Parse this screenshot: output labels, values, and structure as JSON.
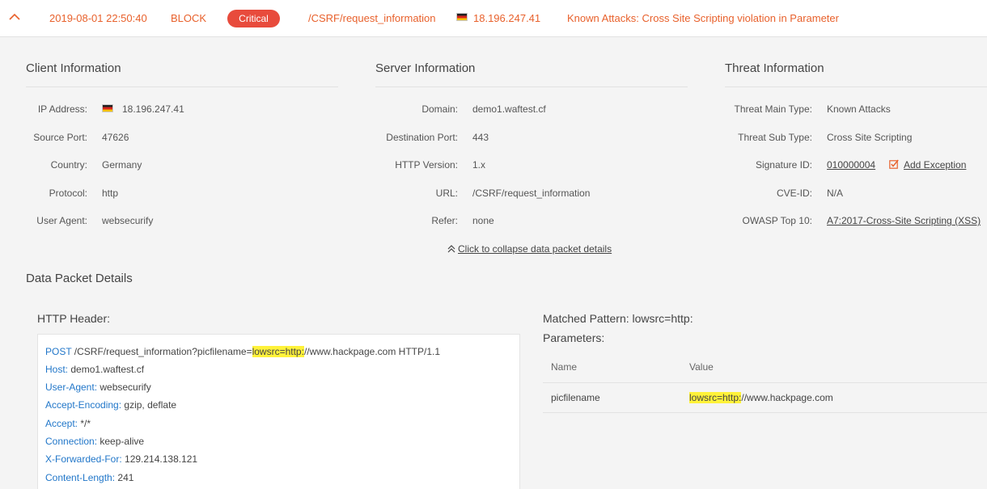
{
  "event": {
    "timestamp": "2019-08-01 22:50:40",
    "action": "BLOCK",
    "severity": "Critical",
    "url": "/CSRF/request_information",
    "ip": "18.196.247.41",
    "description": "Known Attacks: Cross Site Scripting violation in Parameter"
  },
  "client": {
    "title": "Client Information",
    "labels": {
      "ip": "IP Address:",
      "port": "Source Port:",
      "country": "Country:",
      "protocol": "Protocol:",
      "agent": "User Agent:"
    },
    "values": {
      "ip": "18.196.247.41",
      "port": "47626",
      "country": "Germany",
      "protocol": "http",
      "agent": "websecurify"
    }
  },
  "server": {
    "title": "Server Information",
    "labels": {
      "domain": "Domain:",
      "port": "Destination Port:",
      "http": "HTTP Version:",
      "url": "URL:",
      "refer": "Refer:"
    },
    "values": {
      "domain": "demo1.waftest.cf",
      "port": "443",
      "http": "1.x",
      "url": "/CSRF/request_information",
      "refer": "none"
    }
  },
  "threat": {
    "title": "Threat Information",
    "labels": {
      "main": "Threat Main Type:",
      "sub": "Threat Sub Type:",
      "sig": "Signature ID:",
      "cve": "CVE-ID:",
      "owasp": "OWASP Top 10:"
    },
    "values": {
      "main": "Known Attacks",
      "sub": "Cross Site Scripting",
      "sig": "010000004",
      "add_exception": "Add Exception",
      "cve": "N/A",
      "owasp": "A7:2017-Cross-Site Scripting (XSS)"
    }
  },
  "collapse_label": "Click to collapse data packet details",
  "packet": {
    "title": "Data Packet Details",
    "http_header_title": "HTTP Header:",
    "request_line": {
      "method": "POST",
      "path_before": " /CSRF/request_information?picfilename=",
      "highlight": "lowsrc=http:",
      "path_after": "//www.hackpage.com HTTP/1.1"
    },
    "headers": [
      {
        "key": "Host:",
        "value": " demo1.waftest.cf"
      },
      {
        "key": "User-Agent:",
        "value": " websecurify"
      },
      {
        "key": "Accept-Encoding:",
        "value": " gzip, deflate"
      },
      {
        "key": "Accept:",
        "value": " */*"
      },
      {
        "key": "Connection:",
        "value": " keep-alive"
      },
      {
        "key": "X-Forwarded-For:",
        "value": " 129.214.138.121"
      },
      {
        "key": "Content-Length:",
        "value": " 241"
      }
    ],
    "matched_pattern": "Matched Pattern: lowsrc=http:",
    "parameters_title": "Parameters:",
    "param_headers": {
      "name": "Name",
      "value": "Value"
    },
    "param": {
      "name": "picfilename",
      "value_highlight": "lowsrc=http:",
      "value_rest": "//www.hackpage.com"
    }
  },
  "colors": {
    "accent": "#e8612c",
    "critical": "#e84b3c",
    "link_blue": "#2277c9",
    "highlight": "#fff23a"
  }
}
